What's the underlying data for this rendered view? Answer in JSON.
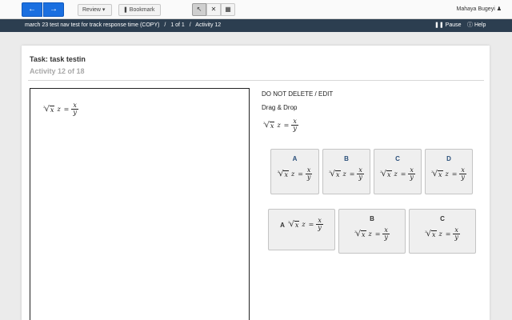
{
  "toolbar": {
    "back_icon": "←",
    "forward_icon": "→",
    "review_label": "Review ▾",
    "bookmark_label": "❚ Bookmark",
    "pointer_icon": "↖",
    "cross_icon": "✕",
    "calc_icon": "▦",
    "user_name": "Mahaya Bugeyi",
    "user_icon": "♟"
  },
  "statusbar": {
    "test_name": "march 23 test nav test for track response time (COPY)",
    "page": "1 of 1",
    "activity": "Activity 12",
    "pause_label": "❚❚ Pause",
    "help_label": "ⓘ Help",
    "separator": "/"
  },
  "card": {
    "task_title": "Task: task testin",
    "activity_num": "Activity 12 of 18"
  },
  "math": {
    "index": "3",
    "radical": "√",
    "radicand": "x",
    "var": "z",
    "equals": "=",
    "numerator": "x",
    "denominator": "y"
  },
  "question": {
    "heading": "DO NOT DELETE / EDIT",
    "type": "Drag & Drop"
  },
  "tiles_row1": [
    {
      "label": "A"
    },
    {
      "label": "B"
    },
    {
      "label": "C"
    },
    {
      "label": "D"
    }
  ],
  "tiles_row2": [
    {
      "label": "A"
    },
    {
      "label": "B"
    },
    {
      "label": "C"
    }
  ],
  "colors": {
    "accent": "#1a6fe0",
    "statusbar": "#2c3e50",
    "tile_label": "#2a4f7a"
  }
}
